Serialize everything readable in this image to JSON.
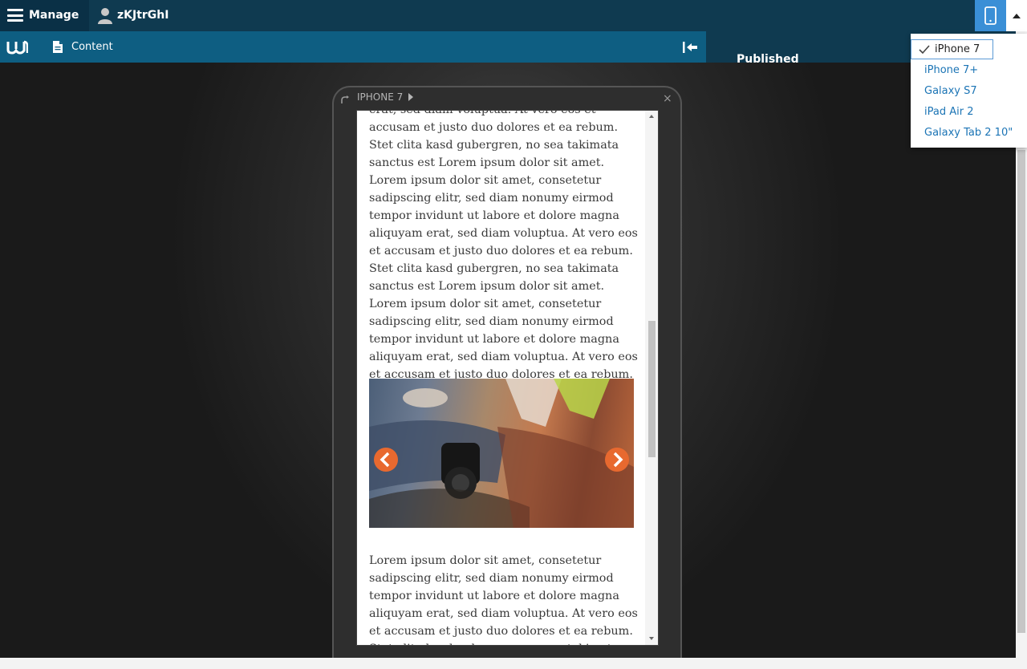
{
  "toolbar": {
    "manage_label": "Manage",
    "user_label": "zKJtrGhI"
  },
  "tray": {
    "content_label": "Content"
  },
  "right_pane": {
    "status": "Published"
  },
  "preview": {
    "device_label": "IPHONE 7",
    "close_glyph": "×",
    "paragraph_1": "erat, sed diam voluptua. At vero eos et accusam et justo duo dolores et ea rebum. Stet clita kasd gubergren, no sea takimata sanctus est Lorem ipsum dolor sit amet. Lorem ipsum dolor sit amet, consetetur sadipscing elitr, sed diam nonumy eirmod tempor invidunt ut labore et dolore magna aliquyam erat, sed diam voluptua. At vero eos et accusam et justo duo dolores et ea rebum. Stet clita kasd gubergren, no sea takimata sanctus est Lorem ipsum dolor sit amet. Lorem ipsum dolor sit amet, consetetur sadipscing elitr, sed diam nonumy eirmod tempor invidunt ut labore et dolore magna aliquyam erat, sed diam voluptua. At vero eos et accusam et justo duo dolores et ea rebum. Stet clita kasd gubergren, no sea takimata sanctus.",
    "paragraph_2": "Lorem ipsum dolor sit amet, consetetur sadipscing elitr, sed diam nonumy eirmod tempor invidunt ut labore et dolore magna aliquyam erat, sed diam voluptua. At vero eos et accusam et justo duo dolores et ea rebum. Stet clita kasd gubergren, no sea takimata"
  },
  "device_menu": {
    "selected": "iPhone 7",
    "items": [
      "iPhone 7+",
      "Galaxy S7",
      "iPad Air 2",
      "Galaxy Tab 2 10\""
    ]
  },
  "colors": {
    "toolbar": "#0f3a50",
    "tray": "#0e5e82",
    "accent": "#3a8fd6",
    "link": "#1b74b5",
    "slider_arrow": "#e8692f"
  },
  "icons": [
    "hamburger-icon",
    "user-icon",
    "mobile-device-icon",
    "caret-up-icon",
    "drupal-logo-icon",
    "document-icon",
    "collapse-tray-icon",
    "rotate-icon",
    "chevron-right-icon",
    "close-icon",
    "chevron-left-icon",
    "checkmark-icon"
  ]
}
